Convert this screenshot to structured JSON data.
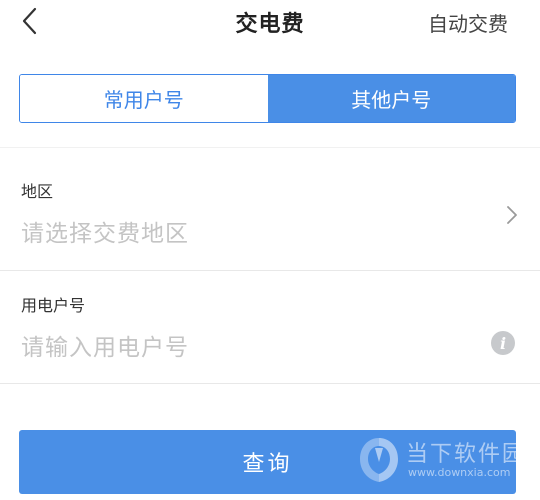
{
  "header": {
    "title": "交电费",
    "right_action": "自动交费",
    "back_icon": "chevron-left-icon"
  },
  "tabs": [
    {
      "label": "常用户号",
      "active": false
    },
    {
      "label": "其他户号",
      "active": true
    }
  ],
  "form": {
    "region": {
      "label": "地区",
      "placeholder": "请选择交费地区",
      "icon": "chevron-right-icon"
    },
    "account": {
      "label": "用电户号",
      "placeholder": "请输入用电户号",
      "icon": "info-icon",
      "info_glyph": "i"
    }
  },
  "query_button": {
    "label": "查询"
  },
  "watermark": {
    "text": "当下软件园",
    "url": "www.downxia.com"
  },
  "colors": {
    "accent": "#4a8fe6",
    "border_accent": "#3f86e8",
    "placeholder": "#c4c4c4",
    "divider": "#e8e8e8",
    "info_icon_bg": "#c7c9cc"
  }
}
